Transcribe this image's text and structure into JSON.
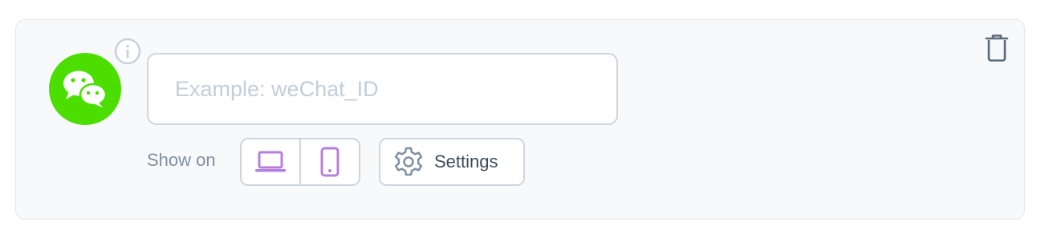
{
  "social_item": {
    "network_icon": "wechat-icon",
    "brand_color": "#4cde00",
    "info_icon": "info-icon",
    "input": {
      "value": "",
      "placeholder": "Example: weChat_ID"
    },
    "show_on_label": "Show on",
    "devices": [
      {
        "icon": "laptop-icon",
        "active": true
      },
      {
        "icon": "mobile-icon",
        "active": true
      }
    ],
    "device_active_color": "#b57fe0",
    "settings_label": "Settings",
    "settings_icon": "gear-icon",
    "delete_icon": "trash-icon"
  }
}
